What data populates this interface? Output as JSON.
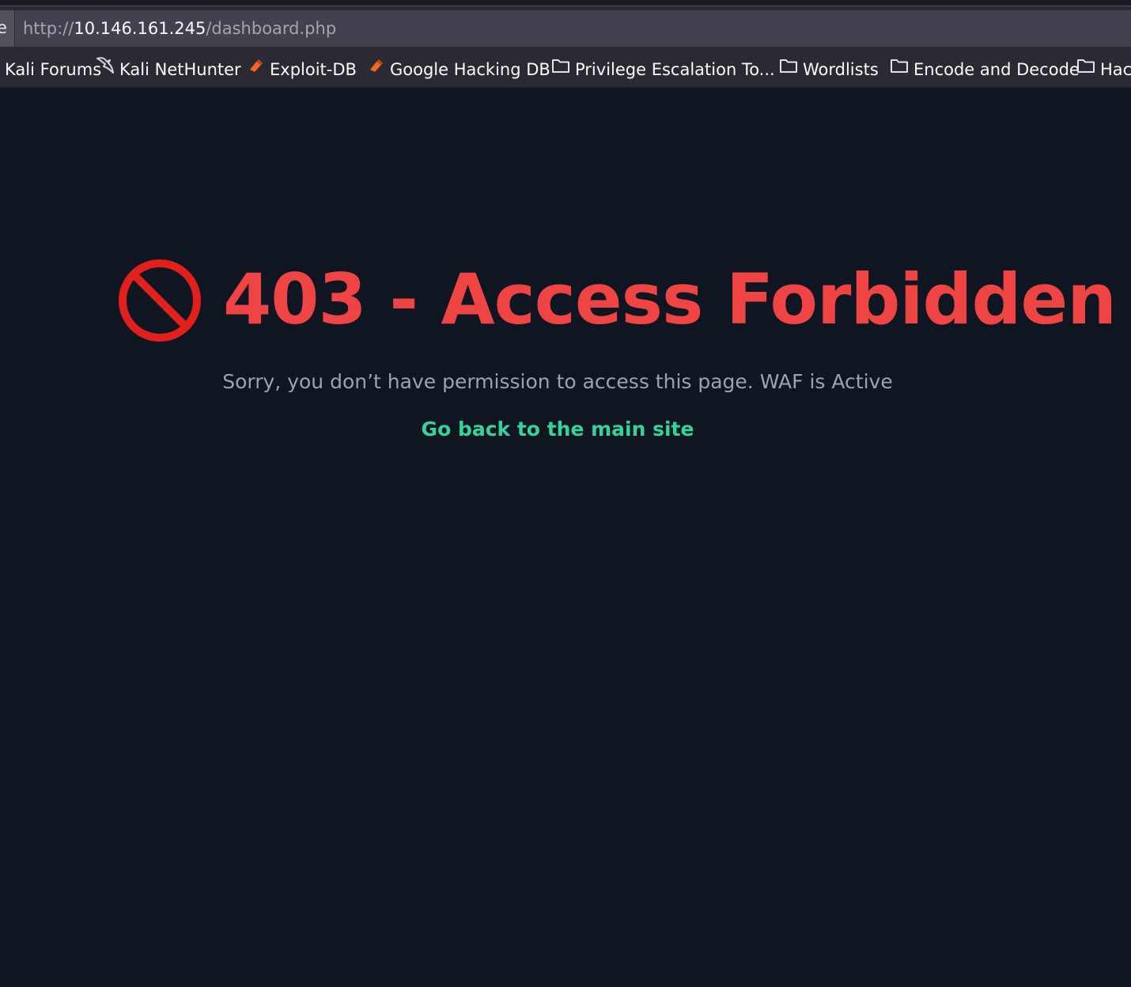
{
  "browser": {
    "url_edge_glyph": "e",
    "url_scheme": "http://",
    "url_host": "10.146.161.245",
    "url_path": "/dashboard.php",
    "bookmarks": [
      {
        "label": "Kali Forums",
        "icon": "kali-forums-icon"
      },
      {
        "label": "Kali NetHunter",
        "icon": "kali-dragon-icon"
      },
      {
        "label": "Exploit-DB",
        "icon": "exploit-db-icon"
      },
      {
        "label": "Google Hacking DB",
        "icon": "ghdb-icon"
      },
      {
        "label": "Privilege Escalation To...",
        "icon": "folder-icon"
      },
      {
        "label": "Wordlists",
        "icon": "folder-icon"
      },
      {
        "label": "Encode and Decode",
        "icon": "folder-icon"
      },
      {
        "label": "Hac",
        "icon": "folder-icon"
      }
    ]
  },
  "page": {
    "heading": "403 - Access Forbidden",
    "heading_icon": "prohibited-icon",
    "message": "Sorry, you don’t have permission to access this page. WAF is Active",
    "back_link": "Go back to the main site"
  },
  "colors": {
    "background": "#101522",
    "heading": "#ef4444",
    "message": "#9ca3af",
    "link": "#34d399",
    "chrome": "#2b2a33",
    "urlbar": "#42414d"
  }
}
